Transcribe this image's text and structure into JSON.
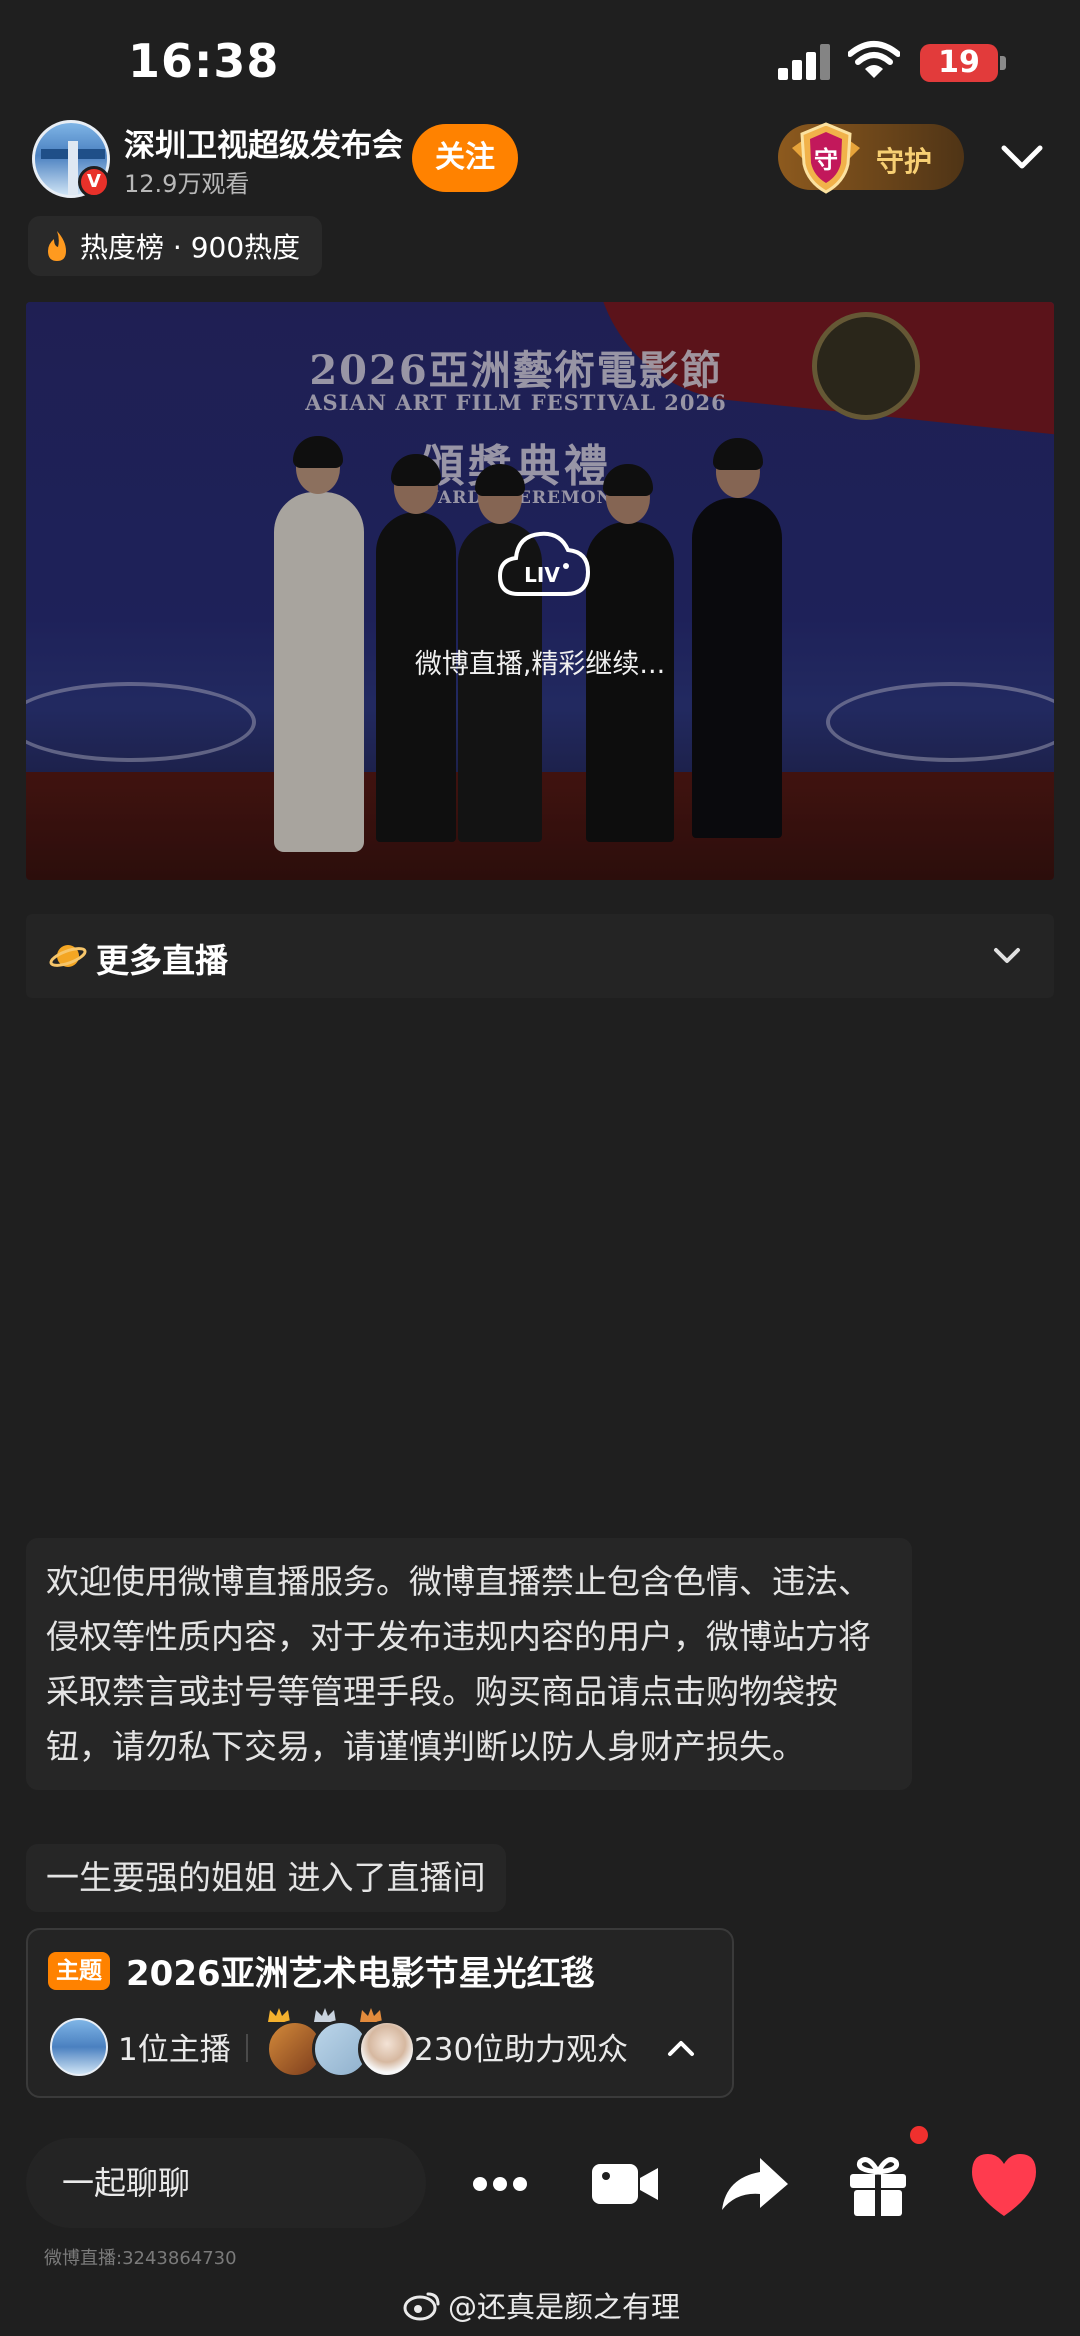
{
  "status_bar": {
    "time": "16:38",
    "battery": "19"
  },
  "header": {
    "channel_name": "深圳卫视超级发布会",
    "viewers": "12.9万观看",
    "follow_label": "关注",
    "guard_label": "守护",
    "guard_badge_char": "守"
  },
  "hot_rank": {
    "text": "热度榜 · 900热度"
  },
  "video": {
    "festival_title_zh": "2026亞洲藝術電影節",
    "festival_title_en": "ASIAN ART FILM FESTIVAL 2026",
    "ceremony_zh": "頒獎典禮",
    "ceremony_en": "AWARDS CEREMONY",
    "live_logo_text": "LIV",
    "status_message": "微博直播,精彩继续..."
  },
  "more_live": {
    "label": "更多直播"
  },
  "chat": {
    "notice": "欢迎使用微博直播服务。微博直播禁止包含色情、违法、侵权等性质内容，对于发布违规内容的用户，微博站方将采取禁言或封号等管理手段。购买商品请点击购物袋按钮，请勿私下交易，请谨慎判断以防人身财产损失。",
    "enter_message": "一生要强的姐姐 进入了直播间"
  },
  "topic": {
    "tag": "主题",
    "title": "2026亚洲艺术电影节星光红毯",
    "host_count": "1位主播",
    "fan_count": "230位助力观众"
  },
  "bottom_bar": {
    "chat_placeholder": "一起聊聊",
    "live_id": "微博直播:3243864730"
  },
  "watermark": "@还真是颜之有理",
  "colors": {
    "accent": "#ff8200",
    "background": "#1f1f1f",
    "like": "#ff3b4e"
  }
}
